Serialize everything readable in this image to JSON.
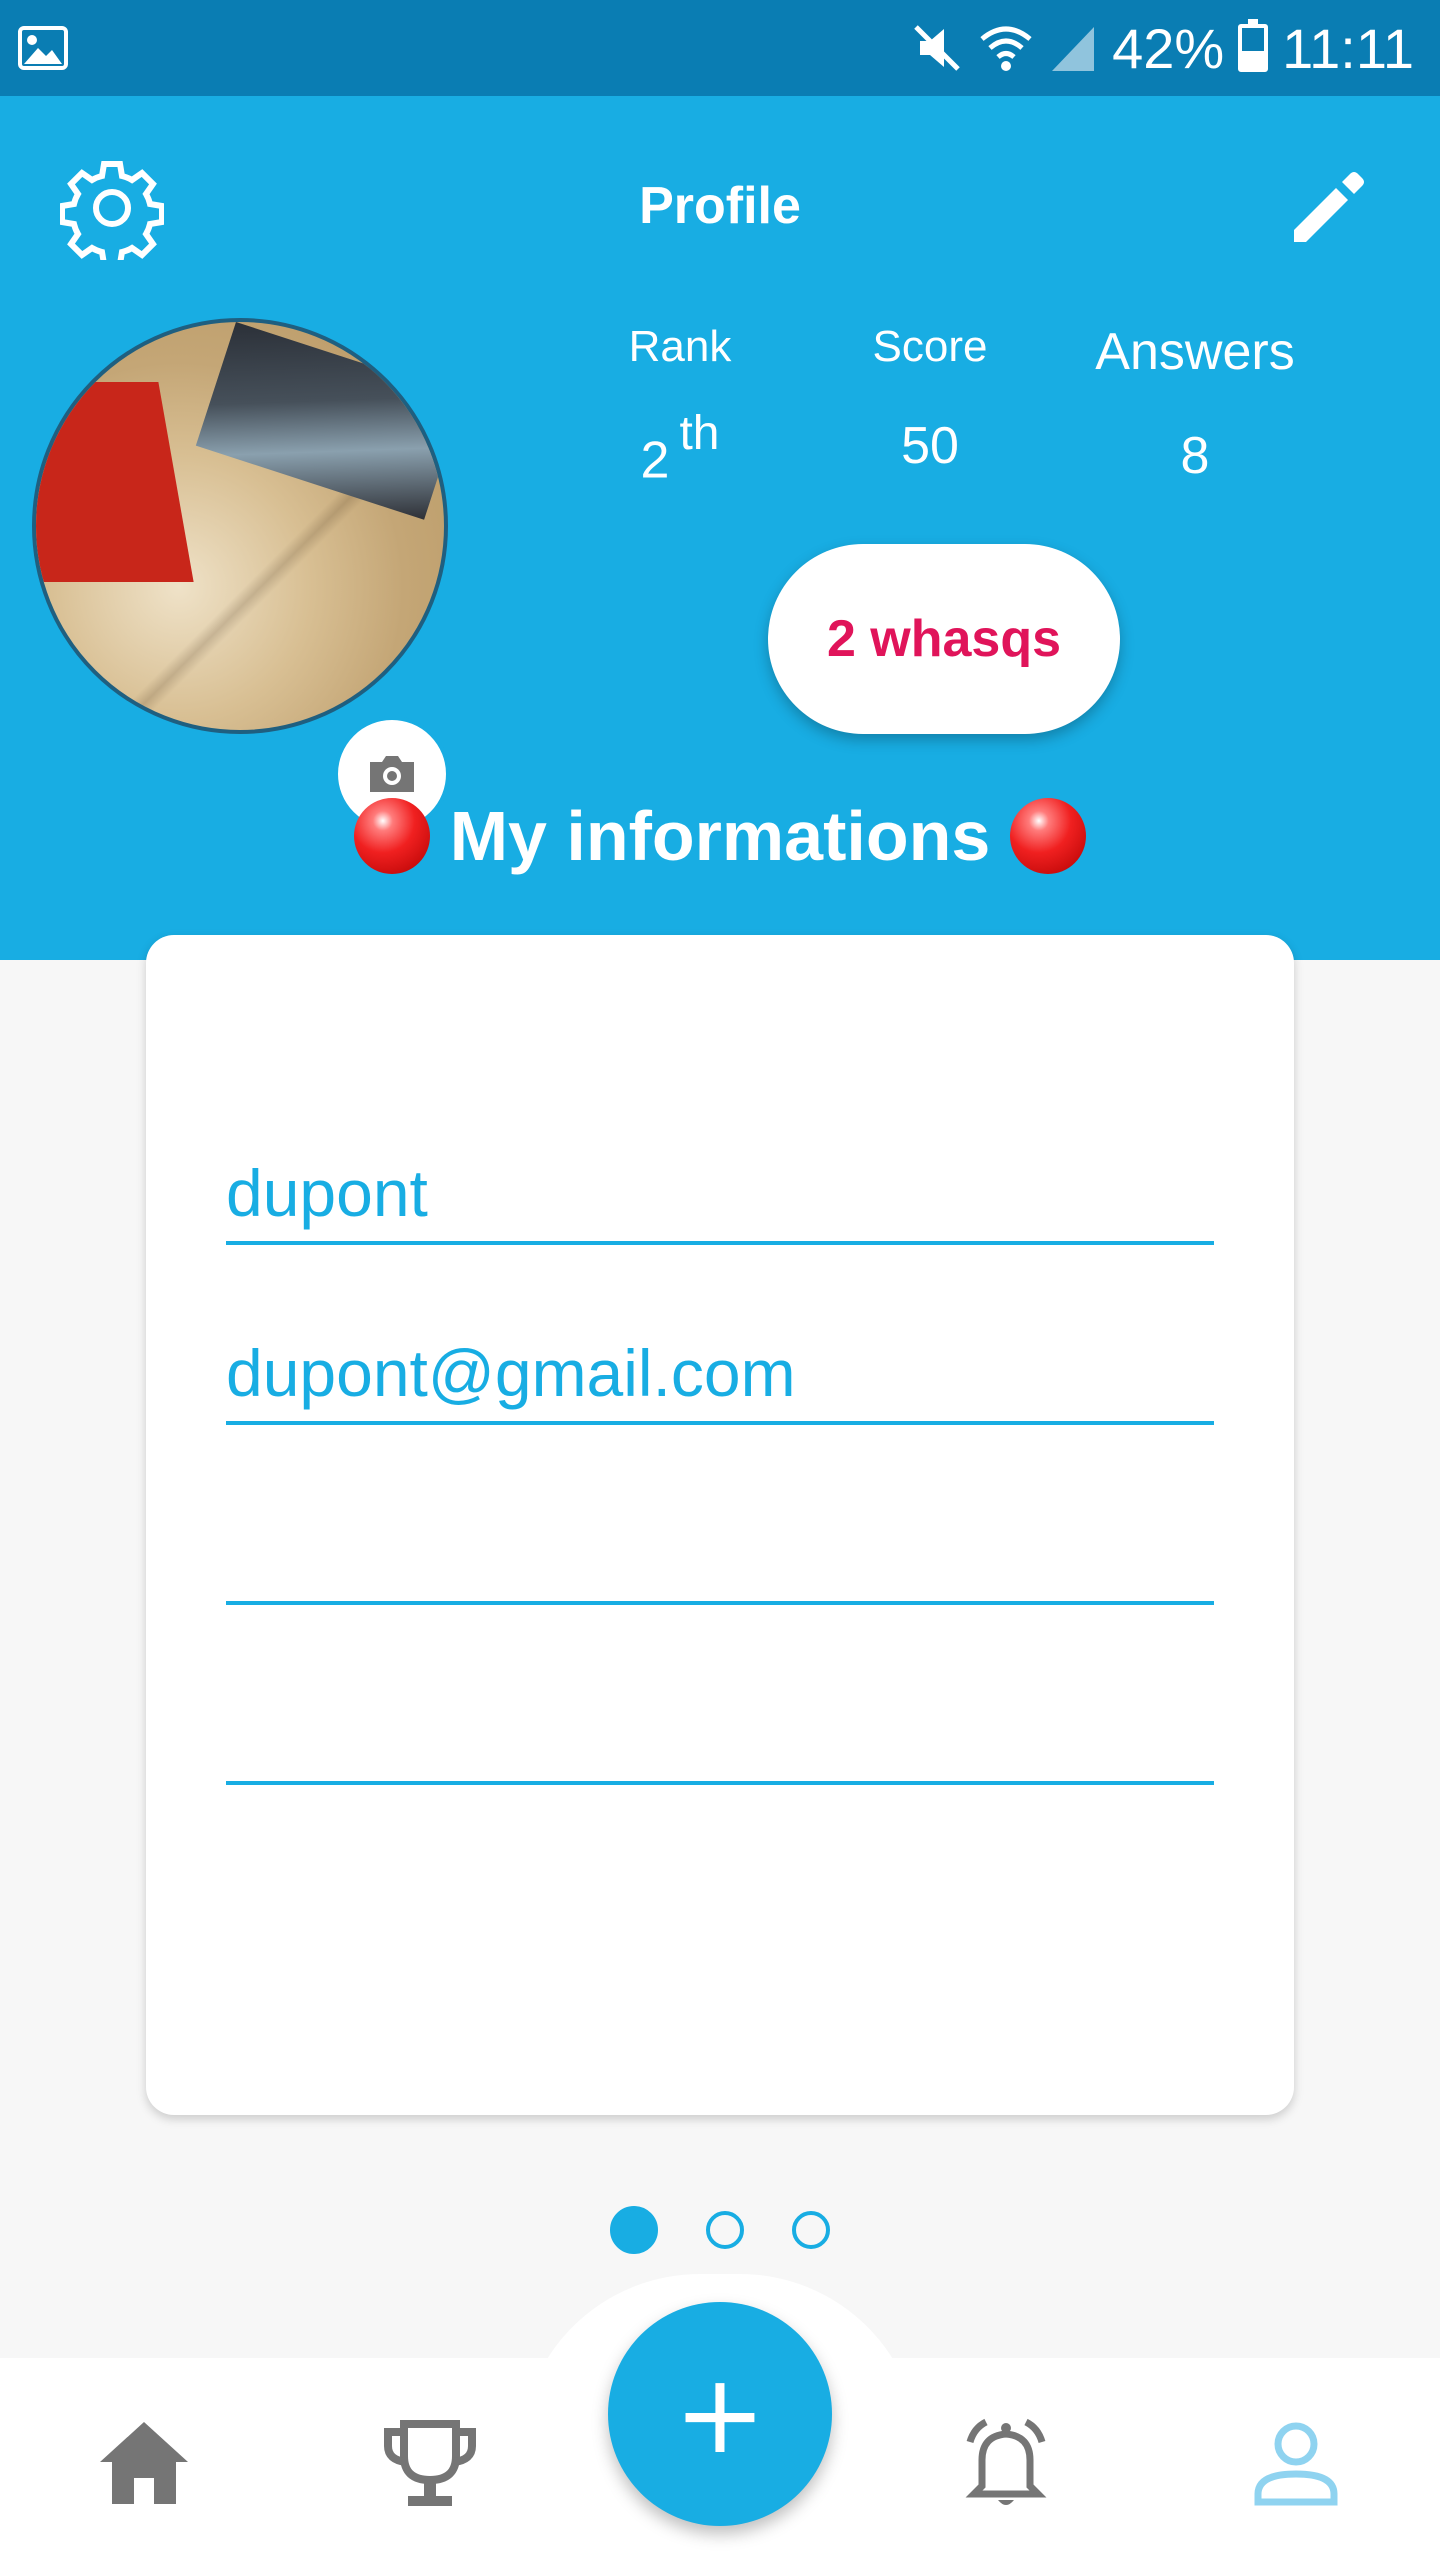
{
  "status_bar": {
    "battery": "42%",
    "time": "11:11",
    "icons": [
      "gallery-icon",
      "mute-icon",
      "wifi-icon",
      "signal-icon",
      "battery-icon"
    ]
  },
  "header": {
    "title": "Profile",
    "left_icon": "gear-icon",
    "right_icon": "pencil-icon"
  },
  "stats": {
    "rank": {
      "label": "Rank",
      "value": "2",
      "suffix": "th"
    },
    "score": {
      "label": "Score",
      "value": "50"
    },
    "answers": {
      "label": "Answers",
      "value": "8"
    }
  },
  "whasqs_button": "2 whasqs",
  "section_title": "My informations",
  "form": {
    "name": "dupont",
    "email": "dupont@gmail.com",
    "field3": "",
    "field4": ""
  },
  "pager": {
    "pages": 3,
    "active": 0
  },
  "nav": {
    "items": [
      "home-icon",
      "trophy-icon",
      "add-button",
      "bell-icon",
      "profile-icon"
    ],
    "fab_label": "+"
  },
  "colors": {
    "primary": "#18ade3",
    "status_bar": "#0a7db3",
    "accent_pink": "#e0145a",
    "nav_gray": "#757575",
    "nav_active": "#8fd3f0"
  }
}
